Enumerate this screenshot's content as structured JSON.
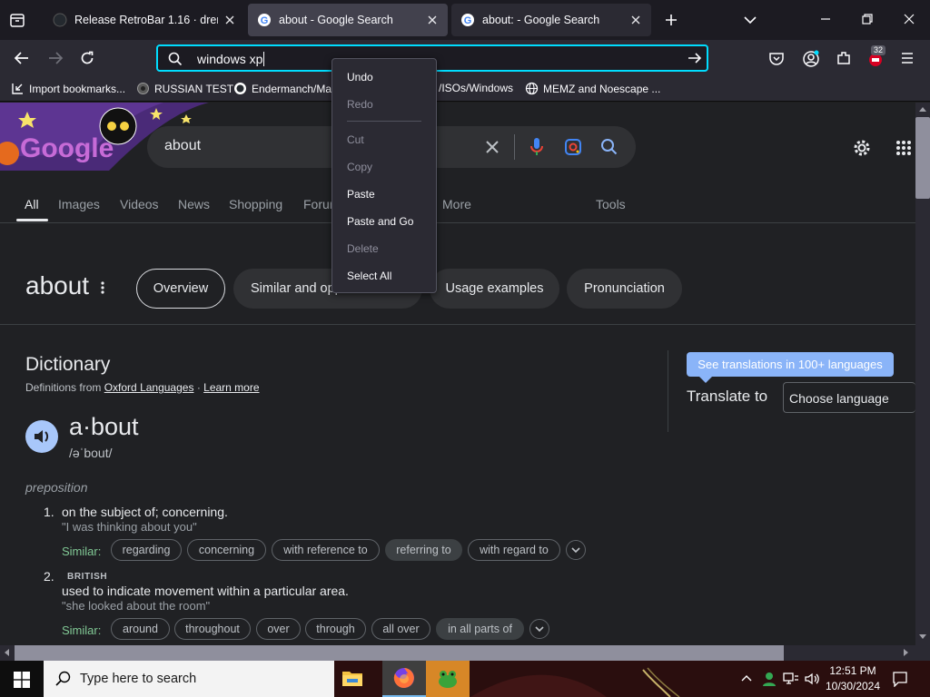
{
  "browser": {
    "tabs": [
      {
        "label": "Release RetroBar 1.16 · dremin/RetroBar",
        "favicon": "github-icon"
      },
      {
        "label": "about - Google Search",
        "favicon": "google-icon",
        "selected": true
      },
      {
        "label": "about: - Google Search",
        "favicon": "google-icon"
      }
    ],
    "address_value": "windows xp",
    "extension_badge": "32",
    "bookmarks": [
      {
        "label": "Import bookmarks...",
        "icon": "import-icon"
      },
      {
        "label": "RUSSIAN TEST",
        "icon": "bookmark-site-icon"
      },
      {
        "label": "Endermanch/Ma",
        "icon": "github-icon"
      },
      {
        "label": "/ISOs/Windows",
        "icon": "folder-icon"
      },
      {
        "label": "MEMZ and Noescape ...",
        "icon": "globe-icon"
      }
    ]
  },
  "context_menu": [
    {
      "label": "Undo",
      "enabled": true
    },
    {
      "label": "Redo",
      "enabled": false
    },
    {
      "label": "Cut",
      "enabled": false
    },
    {
      "label": "Copy",
      "enabled": false
    },
    {
      "label": "Paste",
      "enabled": true
    },
    {
      "label": "Paste and Go",
      "enabled": true
    },
    {
      "label": "Delete",
      "enabled": false
    },
    {
      "label": "Select All",
      "enabled": true
    }
  ],
  "google": {
    "logo": "Google",
    "search_value": "about",
    "nav": [
      "All",
      "Images",
      "Videos",
      "News",
      "Shopping",
      "Forums",
      "More",
      "Tools"
    ],
    "nav_more": "More",
    "nav_tools": "Tools",
    "headword": "about",
    "chips": [
      "Overview",
      "Similar and opposite words",
      "Usage examples",
      "Pronunciation"
    ],
    "dictionary": {
      "title": "Dictionary",
      "from_prefix": "Definitions from",
      "source": "Oxford Languages",
      "sep": "·",
      "learn_more": "Learn more",
      "word": "a·bout",
      "phonetic": "/əˈbout/",
      "pos": "preposition",
      "senses": [
        {
          "num": "1.",
          "definition": "on the subject of; concerning.",
          "example": "\"I was thinking about you\"",
          "similar_label": "Similar:",
          "similar": [
            "regarding",
            "concerning",
            "with reference to",
            "referring to",
            "with regard to"
          ]
        },
        {
          "num": "2.",
          "tag": "BRITISH",
          "definition": "used to indicate movement within a particular area.",
          "example": "\"she looked about the room\"",
          "similar_label": "Similar:",
          "similar": [
            "around",
            "throughout",
            "over",
            "through",
            "all over",
            "in all parts of"
          ]
        }
      ]
    },
    "translate": {
      "tooltip": "See translations in 100+ languages",
      "label": "Translate to",
      "select": "Choose language"
    }
  },
  "taskbar": {
    "search_placeholder": "Type here to search",
    "time": "12:51 PM",
    "date": "10/30/2024"
  },
  "colors": {
    "focus_ring": "#00ddff",
    "page_bg": "#202124",
    "link": "#8ab4f8",
    "similar_label": "#81c995",
    "taskbar_app_bg": "#3a1414"
  }
}
